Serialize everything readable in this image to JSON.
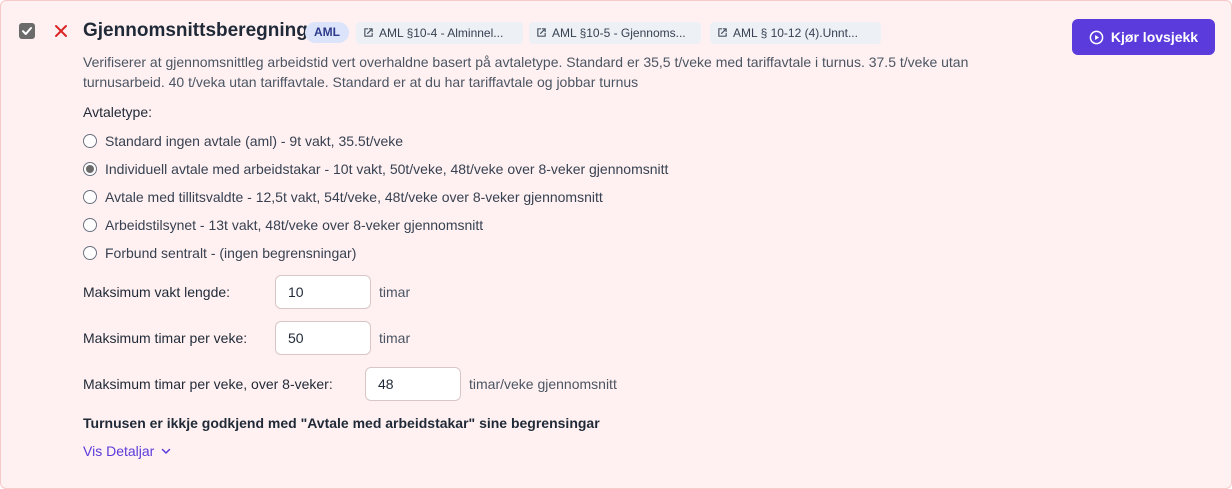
{
  "header": {
    "title": "Gjennomsnittsberegning",
    "badge": "AML",
    "checkbox_checked": true,
    "status_icon": "close-icon",
    "status_color": "#dc2626",
    "references": [
      {
        "label": "AML §10-4 - Alminnel...",
        "icon": "external-link-icon"
      },
      {
        "label": "AML §10-5 - Gjennoms...",
        "icon": "external-link-icon"
      },
      {
        "label": "AML § 10-12 (4).Unnt...",
        "icon": "external-link-icon"
      }
    ],
    "run_button": {
      "label": "Kjør lovsjekk",
      "icon": "play-circle-icon",
      "color": "#5b3bdb"
    }
  },
  "description": "Verifiserer at gjennomsnittleg arbeidstid vert overhaldne basert på avtaletype. Standard er 35,5 t/veke med tariffavtale i turnus. 37.5 t/veke utan turnusarbeid. 40 t/veka utan tariffavtale. Standard er at du har tariffavtale og jobbar turnus",
  "agreement": {
    "label": "Avtaletype:",
    "selected_index": 1,
    "options": [
      "Standard ingen avtale (aml) - 9t vakt, 35.5t/veke",
      "Individuell avtale med arbeidstakar - 10t vakt, 50t/veke, 48t/veke over 8-veker gjennomsnitt",
      "Avtale med tillitsvaldte - 12,5t vakt, 54t/veke, 48t/veke over 8-veker gjennomsnitt",
      "Arbeidstilsynet - 13t vakt, 48t/veke over 8-veker gjennomsnitt",
      "Forbund sentralt - (ingen begrensningar)"
    ]
  },
  "fields": {
    "max_shift": {
      "label": "Maksimum vakt lengde:",
      "value": "10",
      "unit": "timar"
    },
    "max_week": {
      "label": "Maksimum timar per veke:",
      "value": "50",
      "unit": "timar"
    },
    "max_avg": {
      "label": "Maksimum timar per veke, over 8-veker:",
      "value": "48",
      "unit": "timar/veke gjennomsnitt"
    }
  },
  "result": "Turnusen er ikkje godkjend med \"Avtale med arbeidstakar\" sine begrensingar",
  "details_link": {
    "label": "Vis Detaljar",
    "icon": "chevron-down-icon"
  }
}
